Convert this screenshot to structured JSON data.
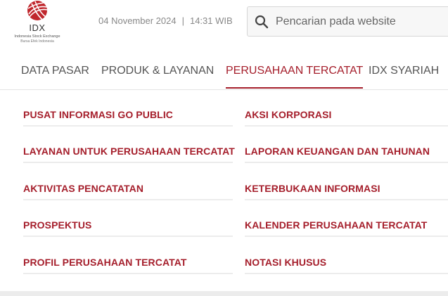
{
  "logo": {
    "name": "IDX",
    "line1": "Indonesia Stock Exchange",
    "line2": "Bursa Efek Indonesia"
  },
  "header": {
    "date": "04 November 2024",
    "separator": "|",
    "time": "14:31 WIB"
  },
  "search": {
    "placeholder": "Pencarian pada website",
    "value": ""
  },
  "nav": {
    "items": [
      {
        "label": "DATA PASAR"
      },
      {
        "label": "PRODUK & LAYANAN"
      },
      {
        "label": "PERUSAHAAN TERCATAT"
      },
      {
        "label": "IDX SYARIAH"
      }
    ]
  },
  "menu": {
    "left": [
      {
        "label": "PUSAT INFORMASI GO PUBLIC"
      },
      {
        "label": "LAYANAN UNTUK PERUSAHAAN TERCATAT"
      },
      {
        "label": "AKTIVITAS PENCATATAN"
      },
      {
        "label": "PROSPEKTUS"
      },
      {
        "label": "PROFIL PERUSAHAAN TERCATAT"
      }
    ],
    "right": [
      {
        "label": "AKSI KORPORASI"
      },
      {
        "label": "LAPORAN KEUANGAN DAN TAHUNAN"
      },
      {
        "label": "KETERBUKAAN INFORMASI"
      },
      {
        "label": "KALENDER PERUSAHAAN TERCATAT"
      },
      {
        "label": "NOTASI KHUSUS"
      }
    ]
  },
  "colors": {
    "accent": "#a51e2b",
    "nav_text": "#555555",
    "muted_text": "#888888"
  }
}
